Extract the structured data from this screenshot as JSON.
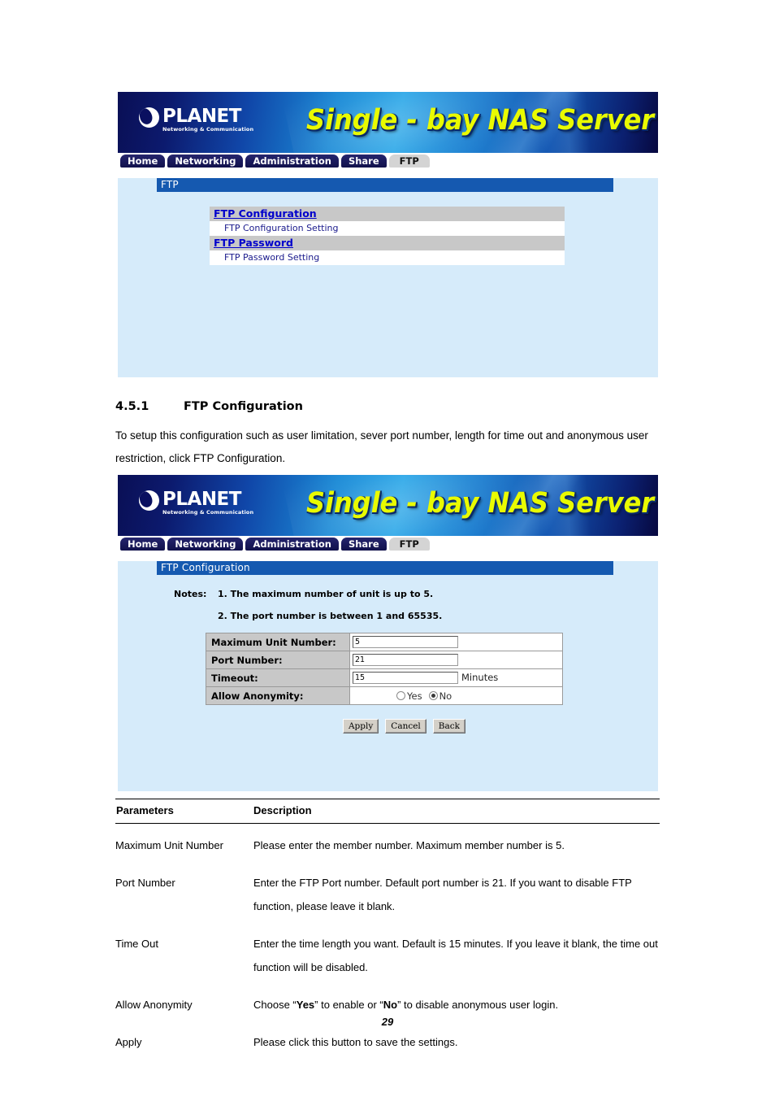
{
  "device_ui": {
    "brand": {
      "logo_wordmark": "PLANET",
      "logo_tagline": "Networking & Communication",
      "banner_title": "Single - bay NAS Server"
    },
    "tabs": [
      {
        "label": "Home",
        "active": false
      },
      {
        "label": "Networking",
        "active": false
      },
      {
        "label": "Administration",
        "active": false
      },
      {
        "label": "Share",
        "active": false
      },
      {
        "label": "FTP",
        "active": true
      }
    ],
    "screen_1": {
      "section_bar": "FTP",
      "menu": [
        {
          "link": "FTP Configuration",
          "sub": "FTP Configuration Setting"
        },
        {
          "link": "FTP Password",
          "sub": "FTP Password Setting"
        }
      ]
    },
    "screen_2": {
      "section_bar": "FTP Configuration",
      "notes_label": "Notes:",
      "notes": [
        "1. The maximum number of unit is up to 5.",
        "2. The port number is between 1 and 65535."
      ],
      "fields": [
        {
          "label": "Maximum Unit Number:",
          "value": "5",
          "unit": ""
        },
        {
          "label": "Port Number:",
          "value": "21",
          "unit": ""
        },
        {
          "label": "Timeout:",
          "value": "15",
          "unit": "Minutes"
        }
      ],
      "anonymity": {
        "label": "Allow Anonymity:",
        "options": [
          {
            "label": "Yes",
            "selected": false
          },
          {
            "label": "No",
            "selected": true
          }
        ]
      },
      "buttons": [
        "Apply",
        "Cancel",
        "Back"
      ]
    }
  },
  "document": {
    "heading_number": "4.5.1",
    "heading_title": "FTP Configuration",
    "paragraph": "To setup this configuration such as user limitation, sever port number, length for time out and anonymous user restriction, click FTP Configuration.",
    "table": {
      "headers": [
        "Parameters",
        "Description"
      ],
      "rows": [
        {
          "parameter": "Maximum Unit Number",
          "description": "Please enter the member number. Maximum member number is 5."
        },
        {
          "parameter": "Port Number",
          "description": "Enter the FTP Port number. Default port number is 21. If you want to disable FTP function, please leave it blank."
        },
        {
          "parameter": "Time Out",
          "description": "Enter the time length you want. Default is 15 minutes. If you leave it blank, the time out function will be disabled."
        },
        {
          "parameter": "Allow Anonymity",
          "description_prefix": "Choose “",
          "description_bold1": "Yes",
          "description_mid": "” to enable or “",
          "description_bold2": "No",
          "description_suffix": "” to disable anonymous user login."
        },
        {
          "parameter": "Apply",
          "description": "Please click this button to save the settings."
        }
      ]
    },
    "page_number": "29"
  },
  "colors": {
    "banner_dark": "#0a0f55",
    "banner_light": "#2ba7e8",
    "banner_title": "#e9fb00",
    "tab_inactive": "#1b1b5e",
    "tab_active": "#d4d4d4",
    "panel_bg": "#d6ebfa",
    "section_bar": "#1559b0",
    "menu_head_bg": "#c8c8c8",
    "link": "#0000cc"
  }
}
